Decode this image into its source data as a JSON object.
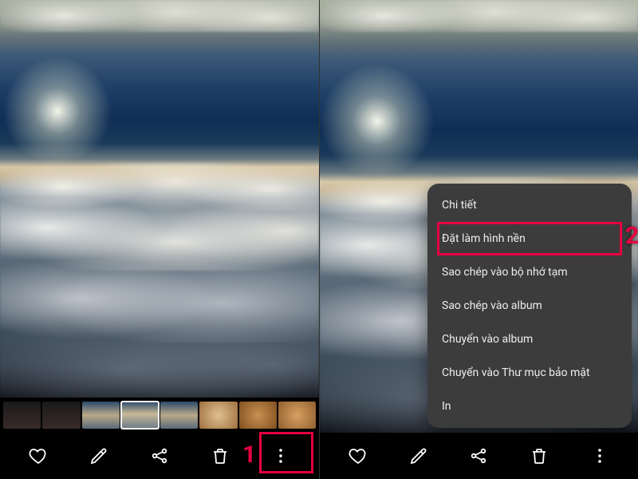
{
  "callouts": {
    "one": "1",
    "two": "2"
  },
  "popup": {
    "items": [
      "Chi tiết",
      "Đặt làm hình nền",
      "Sao chép vào bộ nhớ tạm",
      "Sao chép vào album",
      "Chuyển vào album",
      "Chuyển vào Thư mục bảo mật",
      "In"
    ],
    "highlighted_index": 1
  },
  "action_icons": {
    "favorite": "heart-icon",
    "edit": "pencil-icon",
    "share": "share-icon",
    "delete": "trash-icon",
    "more": "more-vertical-icon"
  },
  "thumbnails": {
    "count": 8,
    "selected_index": 3
  },
  "photo_subject": "aerial view of clouds from airplane with sun glare and blue sky"
}
